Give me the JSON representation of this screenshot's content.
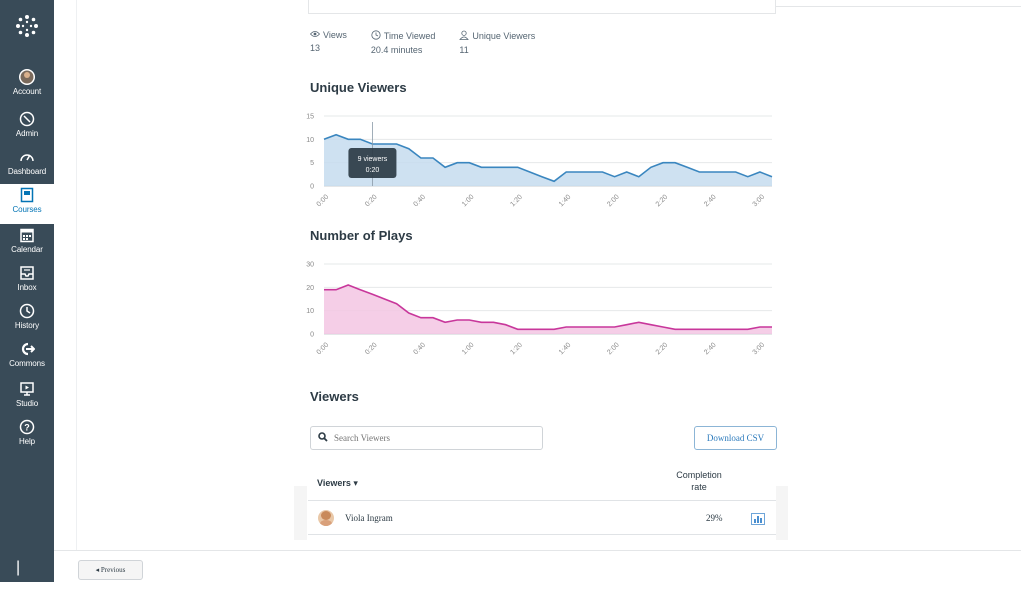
{
  "nav": {
    "items": [
      {
        "key": "account",
        "label": "Account",
        "icon": "avatar-icon"
      },
      {
        "key": "admin",
        "label": "Admin",
        "icon": "shield-icon"
      },
      {
        "key": "dashboard",
        "label": "Dashboard",
        "icon": "gauge-icon"
      },
      {
        "key": "courses",
        "label": "Courses",
        "icon": "book-icon",
        "active": true
      },
      {
        "key": "calendar",
        "label": "Calendar",
        "icon": "calendar-icon"
      },
      {
        "key": "inbox",
        "label": "Inbox",
        "icon": "inbox-icon"
      },
      {
        "key": "history",
        "label": "History",
        "icon": "clock-icon"
      },
      {
        "key": "commons",
        "label": "Commons",
        "icon": "commons-icon"
      },
      {
        "key": "studio",
        "label": "Studio",
        "icon": "studio-icon"
      },
      {
        "key": "help",
        "label": "Help",
        "icon": "help-icon"
      }
    ],
    "collapse_glyph": "|←"
  },
  "stats": {
    "views_label": "Views",
    "views_value": "13",
    "time_label": "Time Viewed",
    "time_value": "20.4 minutes",
    "unique_label": "Unique Viewers",
    "unique_value": "11"
  },
  "unique_viewers": {
    "title": "Unique Viewers",
    "tooltip_line1": "9 viewers",
    "tooltip_line2": "0:20"
  },
  "number_of_plays": {
    "title": "Number of Plays"
  },
  "viewers": {
    "title": "Viewers",
    "search_placeholder": "Search Viewers",
    "download_label": "Download CSV",
    "col_viewers": "Viewers ▾",
    "col_completion_1": "Completion",
    "col_completion_2": "rate",
    "rows": [
      {
        "name": "Viola Ingram",
        "completion": "29%"
      }
    ]
  },
  "footer": {
    "previous_label": "◂ Previous"
  },
  "colors": {
    "nav_bg": "#394b58",
    "accent_blue": "#2b7abc",
    "chart1_line": "#3a86bf",
    "chart1_fill": "#c5dcef",
    "chart2_line": "#c8379b",
    "chart2_fill": "#f3c6e3"
  },
  "chart_data": [
    {
      "type": "area",
      "title": "Unique Viewers",
      "x_ticks": [
        "0:00",
        "0:20",
        "0:40",
        "1:00",
        "1:20",
        "1:40",
        "2:00",
        "2:20",
        "2:40",
        "3:00"
      ],
      "y_ticks": [
        "0",
        "5",
        "10",
        "15"
      ],
      "ylim": [
        0,
        15
      ],
      "xlim": [
        0,
        185
      ],
      "grid": true,
      "x": [
        0,
        5,
        10,
        15,
        20,
        25,
        30,
        35,
        40,
        45,
        50,
        55,
        60,
        65,
        70,
        75,
        80,
        85,
        90,
        95,
        100,
        105,
        110,
        115,
        120,
        125,
        130,
        135,
        140,
        145,
        150,
        155,
        160,
        165,
        170,
        175,
        180,
        185
      ],
      "y": [
        10,
        11,
        10,
        10,
        9,
        9,
        9,
        8,
        6,
        6,
        4,
        5,
        5,
        4,
        4,
        4,
        4,
        3,
        2,
        1,
        3,
        3,
        3,
        3,
        2,
        3,
        2,
        4,
        5,
        5,
        4,
        3,
        3,
        3,
        3,
        2,
        3,
        2
      ]
    },
    {
      "type": "area",
      "title": "Number of Plays",
      "x_ticks": [
        "0:00",
        "0:20",
        "0:40",
        "1:00",
        "1:20",
        "1:40",
        "2:00",
        "2:20",
        "2:40",
        "3:00"
      ],
      "y_ticks": [
        "0",
        "10",
        "20",
        "30"
      ],
      "ylim": [
        0,
        30
      ],
      "xlim": [
        0,
        185
      ],
      "grid": true,
      "x": [
        0,
        5,
        10,
        15,
        20,
        25,
        30,
        35,
        40,
        45,
        50,
        55,
        60,
        65,
        70,
        75,
        80,
        85,
        90,
        95,
        100,
        105,
        110,
        115,
        120,
        125,
        130,
        135,
        140,
        145,
        150,
        155,
        160,
        165,
        170,
        175,
        180,
        185
      ],
      "y": [
        19,
        19,
        21,
        19,
        17,
        15,
        13,
        9,
        7,
        7,
        5,
        6,
        6,
        5,
        5,
        4,
        2,
        2,
        2,
        2,
        3,
        3,
        3,
        3,
        3,
        4,
        5,
        4,
        3,
        2,
        2,
        2,
        2,
        2,
        2,
        2,
        3,
        3
      ]
    }
  ]
}
